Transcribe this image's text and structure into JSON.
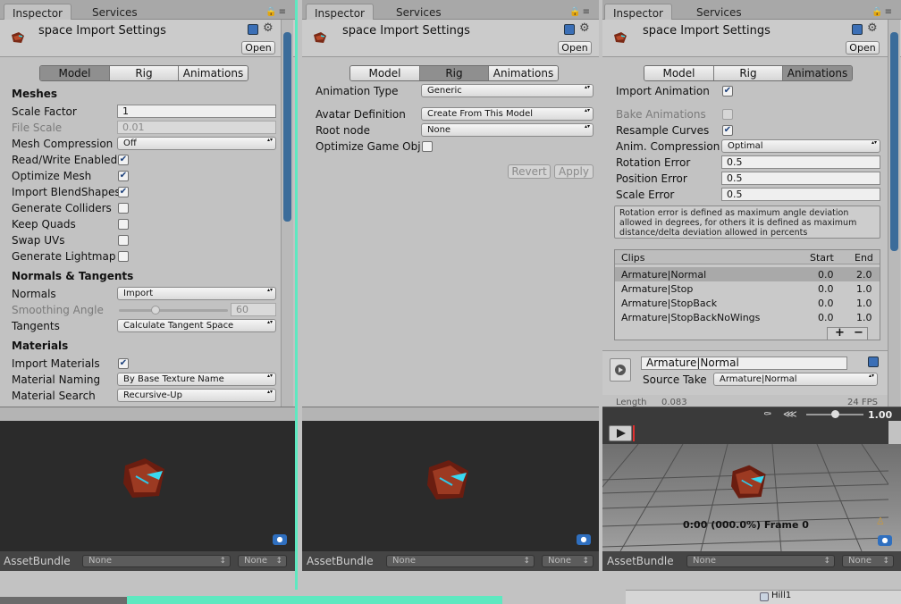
{
  "panels": [
    {
      "tabs": [
        "Inspector",
        "Services"
      ],
      "title": "space Import Settings",
      "open_label": "Open",
      "modes": [
        "Model",
        "Rig",
        "Animations"
      ],
      "active_mode": "Model",
      "model": {
        "meshes_header": "Meshes",
        "scale_factor_label": "Scale Factor",
        "scale_factor": "1",
        "file_scale_label": "File Scale",
        "file_scale": "0.01",
        "mesh_compression_label": "Mesh Compression",
        "mesh_compression": "Off",
        "read_write_label": "Read/Write Enabled",
        "optimize_mesh_label": "Optimize Mesh",
        "import_blendshapes_label": "Import BlendShapes",
        "generate_colliders_label": "Generate Colliders",
        "keep_quads_label": "Keep Quads",
        "swap_uvs_label": "Swap UVs",
        "generate_lightmap_label": "Generate Lightmap U",
        "normals_header": "Normals & Tangents",
        "normals_label": "Normals",
        "normals": "Import",
        "smoothing_label": "Smoothing Angle",
        "smoothing": "60",
        "smoothing_level": 0.33,
        "tangents_label": "Tangents",
        "tangents": "Calculate Tangent Space",
        "materials_header": "Materials",
        "import_materials_label": "Import Materials",
        "material_naming_label": "Material Naming",
        "material_naming": "By Base Texture Name",
        "material_search_label": "Material Search",
        "material_search": "Recursive-Up"
      },
      "asset_bundle_label": "AssetBundle",
      "asset_bundle_value": "None",
      "asset_variant_value": "None"
    },
    {
      "tabs": [
        "Inspector",
        "Services"
      ],
      "title": "space Import Settings",
      "open_label": "Open",
      "modes": [
        "Model",
        "Rig",
        "Animations"
      ],
      "active_mode": "Rig",
      "rig": {
        "animation_type_label": "Animation Type",
        "animation_type": "Generic",
        "avatar_definition_label": "Avatar Definition",
        "avatar_definition": "Create From This Model",
        "root_node_label": "Root node",
        "root_node": "None",
        "optimize_label": "Optimize Game Obje",
        "revert_label": "Revert",
        "apply_label": "Apply"
      },
      "asset_bundle_label": "AssetBundle",
      "asset_bundle_value": "None",
      "asset_variant_value": "None"
    },
    {
      "tabs": [
        "Inspector",
        "Services"
      ],
      "title": "space Import Settings",
      "open_label": "Open",
      "modes": [
        "Model",
        "Rig",
        "Animations"
      ],
      "active_mode": "Animations",
      "anim": {
        "import_animation_label": "Import Animation",
        "bake_animations_label": "Bake Animations",
        "resample_curves_label": "Resample Curves",
        "anim_compression_label": "Anim. Compression",
        "anim_compression": "Optimal",
        "rotation_error_label": "Rotation Error",
        "rotation_error": "0.5",
        "position_error_label": "Position Error",
        "position_error": "0.5",
        "scale_error_label": "Scale Error",
        "scale_error": "0.5",
        "help_text": "Rotation error is defined as maximum angle deviation allowed in degrees, for others it is defined as maximum distance/delta deviation allowed in percents",
        "clips_header": "Clips",
        "start_header": "Start",
        "end_header": "End",
        "clips": [
          {
            "name": "Armature|Normal",
            "start": "0.0",
            "end": "2.0"
          },
          {
            "name": "Armature|Stop",
            "start": "0.0",
            "end": "1.0"
          },
          {
            "name": "Armature|StopBack",
            "start": "0.0",
            "end": "1.0"
          },
          {
            "name": "Armature|StopBackNoWings",
            "start": "0.0",
            "end": "1.0"
          }
        ],
        "add_label": "+",
        "remove_label": "−",
        "clip_name": "Armature|Normal",
        "source_take_label": "Source Take",
        "source_take": "Armature|Normal",
        "length_label": "Length",
        "length": "0.083",
        "fps": "24 FPS",
        "speed": "1.00",
        "frame_text": "0:00 (000.0%) Frame 0"
      },
      "asset_bundle_label": "AssetBundle",
      "asset_bundle_value": "None",
      "asset_variant_value": "None"
    }
  ],
  "footer": {
    "hierarchy_item": "Hill1"
  },
  "colors": {
    "active_tab": "#8f8f8f",
    "scroll_thumb": "#3b6c9a",
    "checkbox_mark": "#1a3f7a",
    "accent_green": "#5ee8c0",
    "selected_clip": "#a9a9a9"
  }
}
